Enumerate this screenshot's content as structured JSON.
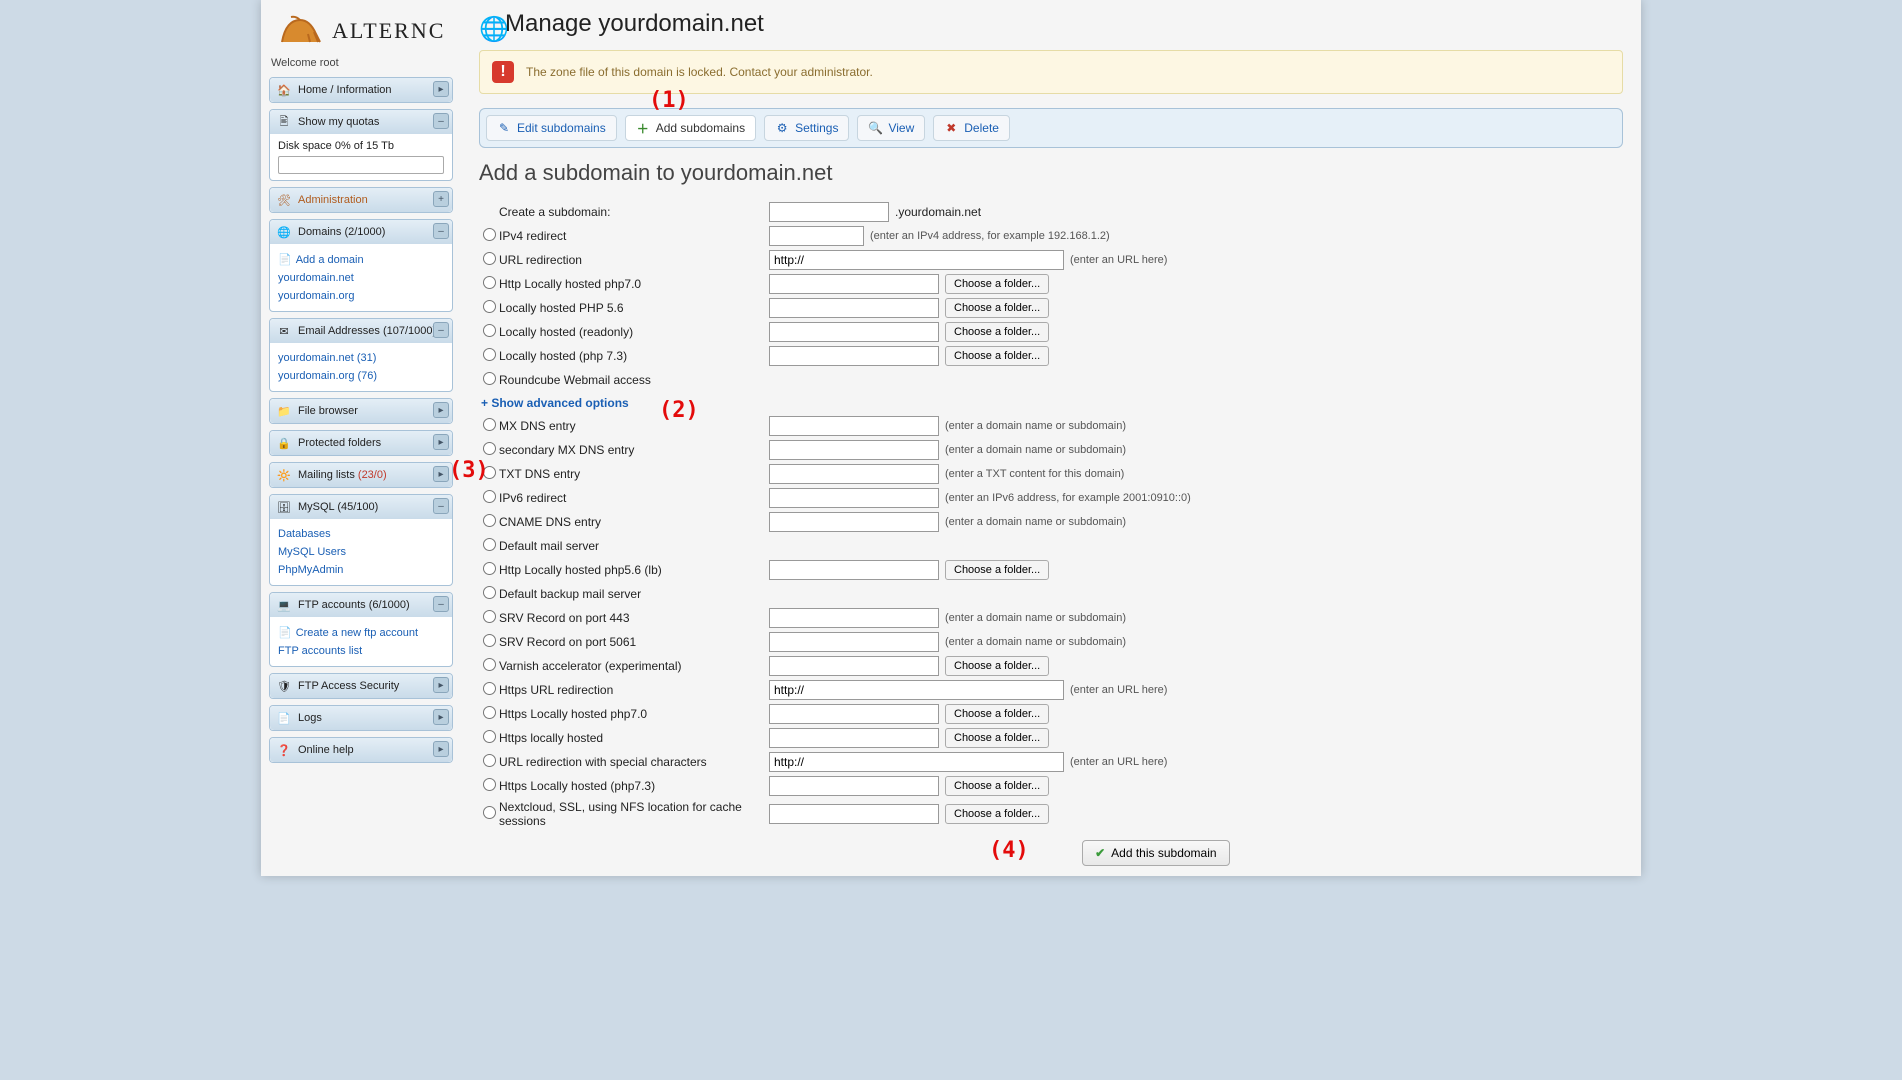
{
  "welcome": "Welcome root",
  "sidebar": {
    "home": "Home / Information",
    "quotas_title": "Show my quotas",
    "disk_quota": "Disk space 0% of 15 Tb",
    "admin": "Administration",
    "domains_title": "Domains (2/1000)",
    "add_domain": "Add a domain",
    "domain1": "yourdomain.net",
    "domain2": "yourdomain.org",
    "emails_title": "Email Addresses (107/1000)",
    "email1": "yourdomain.net (31)",
    "email2": "yourdomain.org (76)",
    "filebrowser": "File browser",
    "protected": "Protected folders",
    "mailing_title": "Mailing lists ",
    "mailing_count": "(23/0)",
    "mysql_title": "MySQL (45/100)",
    "mysql_db": "Databases",
    "mysql_users": "MySQL Users",
    "mysql_pma": "PhpMyAdmin",
    "ftp_title": "FTP accounts (6/1000)",
    "ftp_new": "Create a new ftp account",
    "ftp_list": "FTP accounts list",
    "ftp_sec": "FTP Access Security",
    "logs": "Logs",
    "help": "Online help"
  },
  "page": {
    "title": "Manage yourdomain.net",
    "alert": "The zone file of this domain is locked. Contact your administrator.",
    "tabs": {
      "edit": "Edit subdomains",
      "add": "Add subdomains",
      "settings": "Settings",
      "view": "View",
      "delete": "Delete"
    },
    "subtitle": "Add a subdomain to yourdomain.net",
    "create_label": "Create a subdomain:",
    "domain_suffix": ".yourdomain.net"
  },
  "opts": {
    "ipv4": "IPv4 redirect",
    "url": "URL redirection",
    "php70": "Http Locally hosted php7.0",
    "php56": "Locally hosted PHP 5.6",
    "readonly": "Locally hosted (readonly)",
    "php73": "Locally hosted (php 7.3)",
    "roundcube": "Roundcube Webmail access",
    "adv_link": "+ Show advanced options",
    "mx": "MX DNS entry",
    "mx2": "secondary MX DNS entry",
    "txt": "TXT DNS entry",
    "ipv6": "IPv6 redirect",
    "cname": "CNAME DNS entry",
    "defmail": "Default mail server",
    "php56lb": "Http Locally hosted php5.6 (lb)",
    "bkmail": "Default backup mail server",
    "srv443": "SRV Record on port 443",
    "srv5061": "SRV Record on port 5061",
    "varnish": "Varnish accelerator (experimental)",
    "httpsurl": "Https URL redirection",
    "httpsphp70": "Https Locally hosted php7.0",
    "httpslocal": "Https locally hosted",
    "urlspecial": "URL redirection with special characters",
    "httpsphp73": "Https Locally hosted (php7.3)",
    "nextcloud": "Nextcloud, SSL, using NFS location for cache sessions"
  },
  "hints": {
    "ipv4": "(enter an IPv4 address, for example 192.168.1.2)",
    "url": "(enter an URL here)",
    "domain": "(enter a domain name or subdomain)",
    "txt": "(enter a TXT content for this domain)",
    "ipv6": "(enter an IPv6 address, for example 2001:0910::0)"
  },
  "buttons": {
    "folder": "Choose a folder...",
    "submit": "Add this subdomain"
  },
  "defaults": {
    "http": "http://"
  },
  "annotations": {
    "a1": "(1)",
    "a2": "(2)",
    "a3": "(3)",
    "a4": "(4)"
  }
}
